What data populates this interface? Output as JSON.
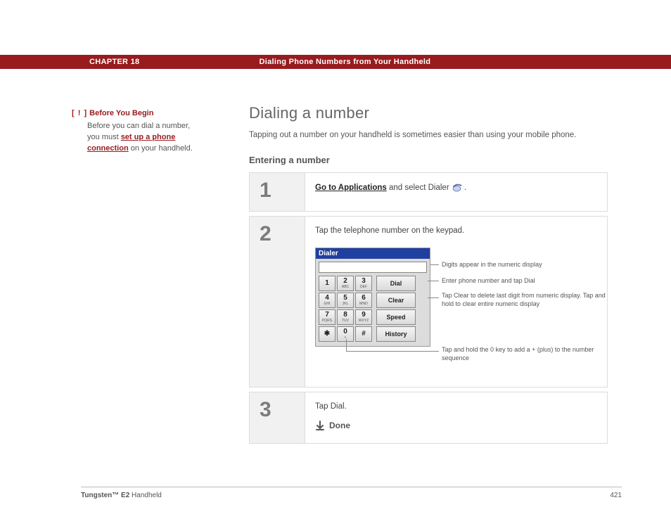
{
  "header": {
    "chapter": "CHAPTER 18",
    "title": "Dialing Phone Numbers from Your Handheld"
  },
  "sidebar": {
    "marker": "[ ! ]",
    "heading": "Before You Begin",
    "body_before": "Before you can dial a number, you must ",
    "link": "set up a phone connection",
    "body_after": " on your handheld."
  },
  "main": {
    "title": "Dialing a number",
    "blurb": "Tapping out a number on your handheld is sometimes easier than using your mobile phone.",
    "subtitle": "Entering a number"
  },
  "steps": {
    "s1": {
      "num": "1",
      "link": "Go to Applications",
      "text": " and select Dialer "
    },
    "s2": {
      "num": "2",
      "text": "Tap the telephone number on the keypad."
    },
    "s3": {
      "num": "3",
      "text": "Tap Dial.",
      "done": "Done"
    }
  },
  "dialer": {
    "title": "Dialer",
    "keys": {
      "k1": "1",
      "k1s": "",
      "k2": "2",
      "k2s": "ABC",
      "k3": "3",
      "k3s": "DEF",
      "k4": "4",
      "k4s": "GHI",
      "k5": "5",
      "k5s": "JKL",
      "k6": "6",
      "k6s": "MNO",
      "k7": "7",
      "k7s": "PQRS",
      "k8": "8",
      "k8s": "TUV",
      "k9": "9",
      "k9s": "WXYZ",
      "kstar": "✱",
      "k0": "0",
      "k0s": "+",
      "khash": "#"
    },
    "side": {
      "dial": "Dial",
      "clear": "Clear",
      "speed": "Speed",
      "history": "History"
    }
  },
  "callouts": {
    "display": "Digits appear in the numeric display",
    "dial": "Enter phone number and tap Dial",
    "clear": "Tap Clear to delete last digit from numeric display. Tap and hold to clear entire numeric display",
    "zero": "Tap and hold the 0 key to add a + (plus) to the number sequence"
  },
  "footer": {
    "product_bold": "Tungsten™ E2",
    "product_rest": " Handheld",
    "page": "421"
  }
}
